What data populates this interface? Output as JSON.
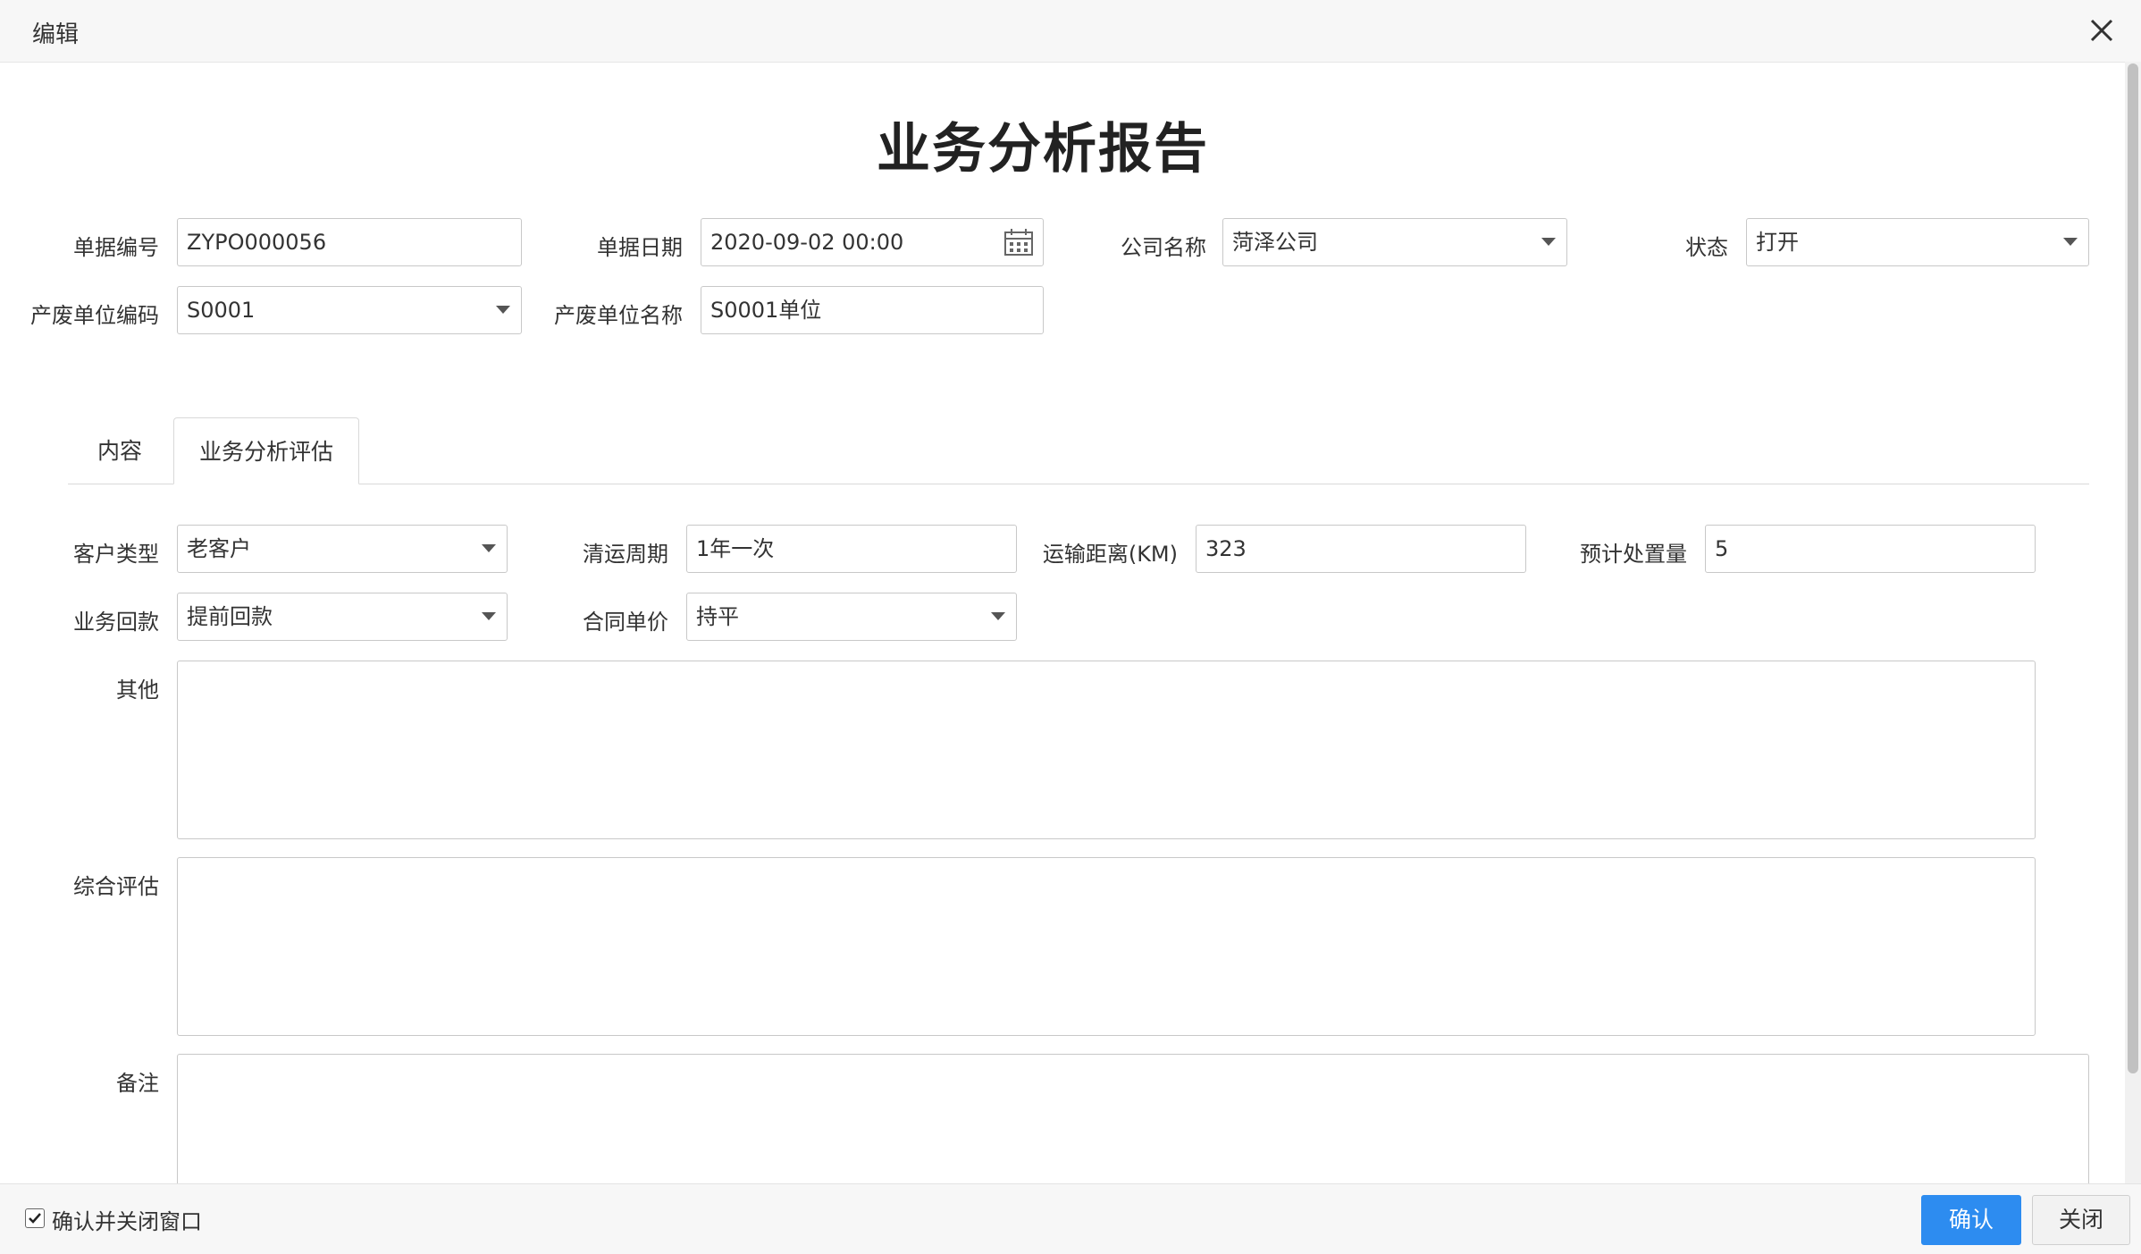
{
  "dialog": {
    "title": "编辑",
    "close_icon": "close-icon"
  },
  "form_title": "业务分析报告",
  "header_fields": {
    "doc_no": {
      "label": "单据编号",
      "value": "ZYPO000056"
    },
    "doc_date": {
      "label": "单据日期",
      "value": "2020-09-02 00:00"
    },
    "company": {
      "label": "公司名称",
      "value": "菏泽公司"
    },
    "status": {
      "label": "状态",
      "value": "打开"
    },
    "unit_code": {
      "label": "产废单位编码",
      "value": "S0001"
    },
    "unit_name": {
      "label": "产废单位名称",
      "value": "S0001单位"
    }
  },
  "tabs": [
    {
      "label": "内容",
      "active": false
    },
    {
      "label": "业务分析评估",
      "active": true
    }
  ],
  "evaluation": {
    "customer_type": {
      "label": "客户类型",
      "value": "老客户"
    },
    "cleanup_cycle": {
      "label": "清运周期",
      "value": "1年一次"
    },
    "distance": {
      "label": "运输距离(KM)",
      "value": "323"
    },
    "expected_volume": {
      "label": "预计处置量",
      "value": "5"
    },
    "payment": {
      "label": "业务回款",
      "value": "提前回款"
    },
    "contract_price": {
      "label": "合同单价",
      "value": "持平"
    },
    "other": {
      "label": "其他",
      "value": ""
    },
    "overall": {
      "label": "综合评估",
      "value": ""
    },
    "remark": {
      "label": "备注",
      "value": ""
    }
  },
  "footer": {
    "close_after_confirm_label": "确认并关闭窗口",
    "close_after_confirm_checked": true,
    "confirm_label": "确认",
    "close_label": "关闭"
  },
  "colors": {
    "primary": "#2d8cf0",
    "border": "#c8c8c8"
  }
}
